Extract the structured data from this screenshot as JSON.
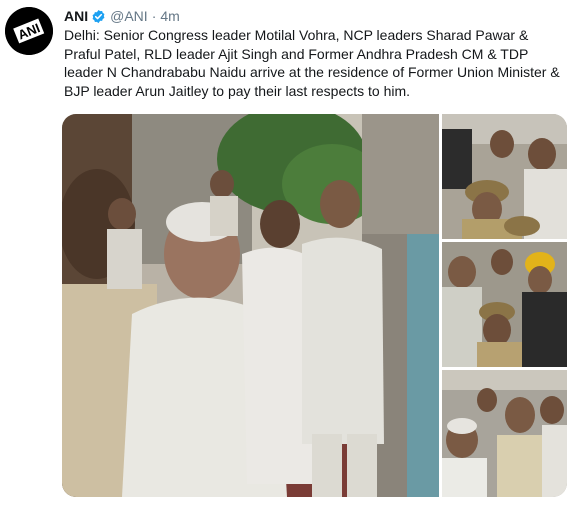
{
  "tweet": {
    "author_name": "ANI",
    "handle": "@ANI",
    "separator": "·",
    "timestamp": "4m",
    "text": "Delhi: Senior Congress leader Motilal Vohra, NCP leaders Sharad Pawar & Praful Patel, RLD leader Ajit Singh and Former Andhra Pradesh CM & TDP leader N Chandrababu Naidu arrive at the residence of Former Union Minister & BJP leader Arun Jaitley to pay their last respects to him.",
    "avatar_logo_text": "ANI",
    "verified_icon": "verified-badge-icon"
  },
  "colors": {
    "text": "#14171a",
    "secondary": "#657786",
    "verified": "#1da1f2",
    "avatar_bg": "#000000"
  },
  "media": {
    "count": 4,
    "layout": "one-large-three-stacked"
  }
}
